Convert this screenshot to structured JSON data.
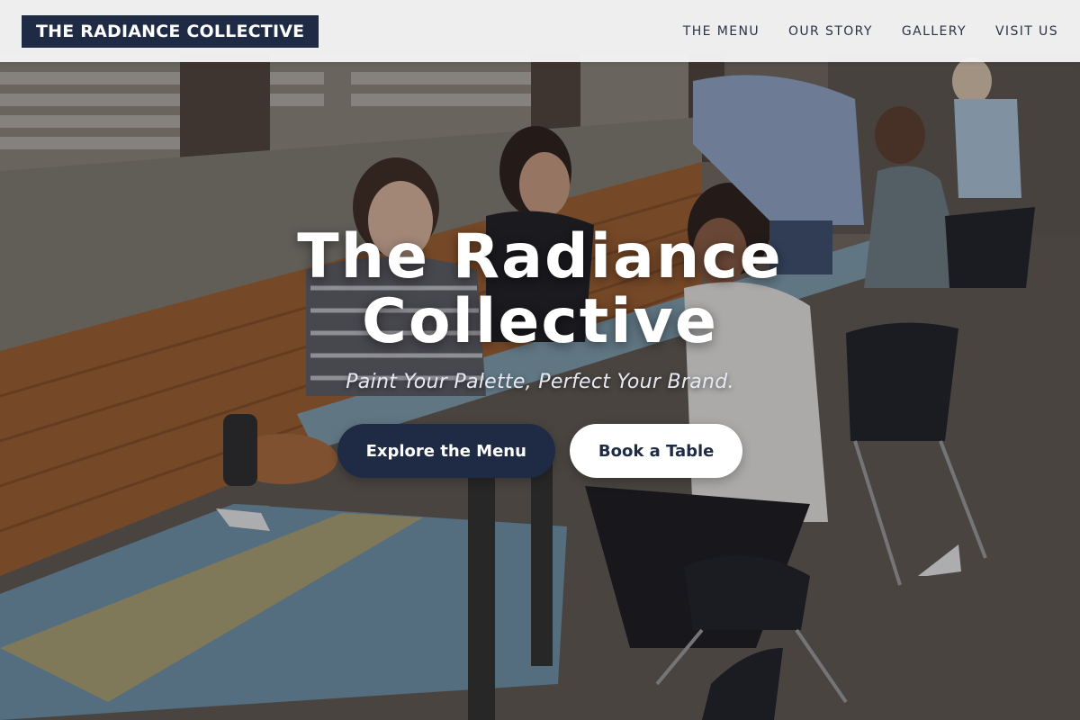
{
  "brand": {
    "name": "THE RADIANCE COLLECTIVE",
    "primary_color": "#1f2a44",
    "nav_background": "#f5f5f5"
  },
  "nav": {
    "items": [
      {
        "label": "THE MENU"
      },
      {
        "label": "OUR STORY"
      },
      {
        "label": "GALLERY"
      },
      {
        "label": "VISIT US"
      }
    ]
  },
  "hero": {
    "title": "The Radiance Collective",
    "tagline": "Paint Your Palette, Perfect Your Brand.",
    "background_image": "outdoor-cafe-diners-photo",
    "primary_cta": "Explore the Menu",
    "secondary_cta": "Book a Table"
  }
}
